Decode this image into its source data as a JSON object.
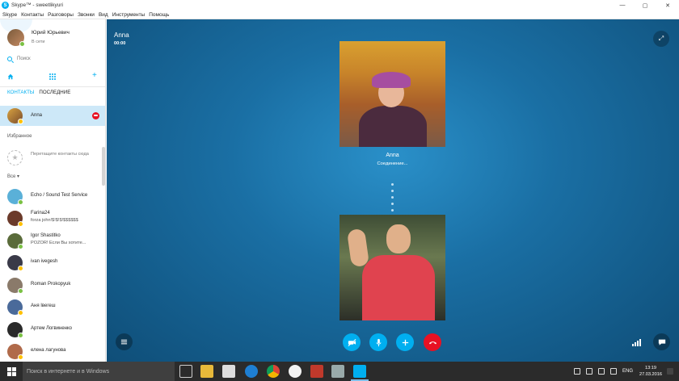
{
  "window": {
    "title": "Skype™ - sweetlikyuri",
    "app_icon_letter": "S",
    "minimize": "—",
    "maximize": "▢",
    "close": "✕"
  },
  "menu": [
    "Skype",
    "Контакты",
    "Разговоры",
    "Звонки",
    "Вид",
    "Инструменты",
    "Помощь"
  ],
  "profile": {
    "name": "Юрий Юрьевич",
    "status": "В сети"
  },
  "search": {
    "placeholder": "Поиск"
  },
  "nav": {
    "add": "+"
  },
  "tabs": {
    "contacts": "КОНТАКТЫ",
    "recent": "ПОСЛЕДНИЕ"
  },
  "active_contact": {
    "name": "Anna"
  },
  "favorites": {
    "label": "Избранное",
    "hint": "Перетащите контакты сюда",
    "star": "★"
  },
  "all_filter": "Все ▾",
  "contacts": [
    {
      "name": "Echo / Sound Test Service",
      "mood": "",
      "status": "online",
      "color": "#5ab0d8"
    },
    {
      "name": "Farina24",
      "mood": "forza john!$!$!$!$$$$$$",
      "status": "away",
      "color": "#6b3a2a"
    },
    {
      "name": "Igor Shastitko",
      "mood": "POZOR! Если Вы хотите...",
      "status": "online",
      "color": "#5a6b3a"
    },
    {
      "name": "ivan ivegesh",
      "mood": "",
      "status": "away",
      "color": "#3a3a48"
    },
    {
      "name": "Roman Prokopyuk",
      "mood": "",
      "status": "online",
      "color": "#8a7a6a"
    },
    {
      "name": "Аня Івегеш",
      "mood": "",
      "status": "away",
      "color": "#4a6a9a"
    },
    {
      "name": "Артем Логвиненко",
      "mood": "",
      "status": "online",
      "color": "#2a2a2a"
    },
    {
      "name": "елена лагунова",
      "mood": "",
      "status": "away",
      "color": "#b06a4a"
    }
  ],
  "call": {
    "name": "Anna",
    "time": "00:00",
    "callee_label": "Anna",
    "state": "Соединение...",
    "expand": "⤢",
    "chat": "💬"
  },
  "taskbar": {
    "search_placeholder": "Поиск в интернете и в Windows",
    "lang": "ENG",
    "time": "13:19",
    "date": "27.03.2016"
  },
  "colors": {
    "accent": "#00aff0",
    "hangup": "#e81123",
    "online": "#7ac143",
    "away": "#ffc000"
  }
}
